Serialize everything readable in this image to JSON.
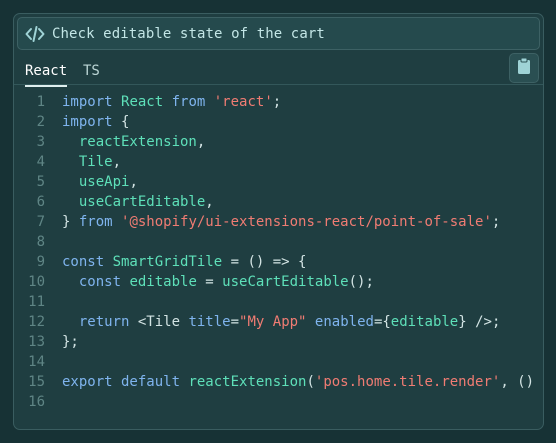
{
  "header": {
    "icon": "code-icon",
    "title": "Check editable state of the cart"
  },
  "tabs": [
    {
      "label": "React",
      "active": true
    },
    {
      "label": "TS",
      "active": false
    }
  ],
  "copy_button": {
    "icon": "clipboard-icon"
  },
  "colors": {
    "keyword": "#7fb4ee",
    "identifier": "#5ee0b9",
    "string": "#f07c73",
    "plain": "#d3e4e4",
    "line_number": "#5f8585"
  },
  "code_lines": [
    {
      "n": "1",
      "tokens": [
        [
          "kw",
          "import "
        ],
        [
          "id",
          "React"
        ],
        [
          "kw",
          " from "
        ],
        [
          "str",
          "'react'"
        ],
        [
          "pl",
          ";"
        ]
      ]
    },
    {
      "n": "2",
      "tokens": [
        [
          "kw",
          "import "
        ],
        [
          "pl",
          "{"
        ]
      ]
    },
    {
      "n": "3",
      "tokens": [
        [
          "pl",
          "  "
        ],
        [
          "id",
          "reactExtension"
        ],
        [
          "pl",
          ","
        ]
      ]
    },
    {
      "n": "4",
      "tokens": [
        [
          "pl",
          "  "
        ],
        [
          "id",
          "Tile"
        ],
        [
          "pl",
          ","
        ]
      ]
    },
    {
      "n": "5",
      "tokens": [
        [
          "pl",
          "  "
        ],
        [
          "id",
          "useApi"
        ],
        [
          "pl",
          ","
        ]
      ]
    },
    {
      "n": "6",
      "tokens": [
        [
          "pl",
          "  "
        ],
        [
          "id",
          "useCartEditable"
        ],
        [
          "pl",
          ","
        ]
      ]
    },
    {
      "n": "7",
      "tokens": [
        [
          "pl",
          "} "
        ],
        [
          "kw",
          "from "
        ],
        [
          "str",
          "'@shopify/ui-extensions-react/point-of-sale'"
        ],
        [
          "pl",
          ";"
        ]
      ]
    },
    {
      "n": "8",
      "tokens": []
    },
    {
      "n": "9",
      "tokens": [
        [
          "kw",
          "const "
        ],
        [
          "id",
          "SmartGridTile"
        ],
        [
          "pl",
          " = () => {"
        ]
      ]
    },
    {
      "n": "10",
      "tokens": [
        [
          "pl",
          "  "
        ],
        [
          "kw",
          "const "
        ],
        [
          "id",
          "editable"
        ],
        [
          "pl",
          " = "
        ],
        [
          "id",
          "useCartEditable"
        ],
        [
          "pl",
          "();"
        ]
      ]
    },
    {
      "n": "11",
      "tokens": []
    },
    {
      "n": "12",
      "tokens": [
        [
          "pl",
          "  "
        ],
        [
          "kw",
          "return "
        ],
        [
          "pl",
          "<Tile "
        ],
        [
          "kw",
          "title"
        ],
        [
          "pl",
          "="
        ],
        [
          "str",
          "\"My App\""
        ],
        [
          "pl",
          " "
        ],
        [
          "kw",
          "enabled"
        ],
        [
          "pl",
          "={"
        ],
        [
          "id",
          "editable"
        ],
        [
          "pl",
          "} />;"
        ]
      ]
    },
    {
      "n": "13",
      "tokens": [
        [
          "pl",
          "};"
        ]
      ]
    },
    {
      "n": "14",
      "tokens": []
    },
    {
      "n": "15",
      "tokens": [
        [
          "kw",
          "export default "
        ],
        [
          "id",
          "reactExtension"
        ],
        [
          "pl",
          "("
        ],
        [
          "str",
          "'pos.home.tile.render'"
        ],
        [
          "pl",
          ", ()"
        ]
      ]
    },
    {
      "n": "16",
      "tokens": []
    }
  ]
}
